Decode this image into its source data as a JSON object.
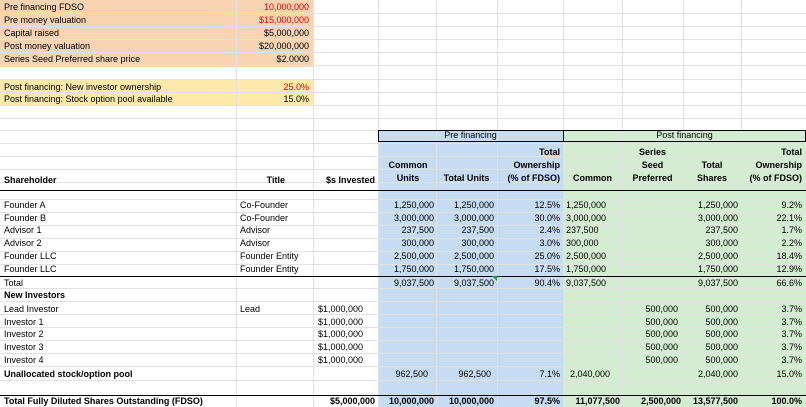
{
  "assumptions": [
    {
      "label": "Pre financing FDSO",
      "value": "10,000,000",
      "red": true
    },
    {
      "label": "Pre money valuation",
      "value": "$15,000,000",
      "red": true
    },
    {
      "label": "Capital raised",
      "value": "$5,000,000",
      "red": false
    },
    {
      "label": "Post money valuation",
      "value": "$20,000,000",
      "red": false
    },
    {
      "label": "Series Seed Preferred share price",
      "value": "$2.0000",
      "red": false
    }
  ],
  "post_assumptions": [
    {
      "label": "Post financing: New investor ownership",
      "value": "25.0%",
      "red": true
    },
    {
      "label": "Post financing: Stock option pool available",
      "value": "15.0%",
      "red": false
    }
  ],
  "groups": {
    "pre": "Pre financing",
    "post": "Post financing"
  },
  "headers": {
    "shareholder": "Shareholder",
    "title": "Title",
    "invested": "$s Invested",
    "common_units_1": "Common",
    "common_units_2": "Units",
    "total_units": "Total Units",
    "pre_own_1": "Total",
    "pre_own_2": "Ownership",
    "pre_own_3": "(% of FDSO)",
    "post_common": "Common",
    "series_1": "Series",
    "series_2": "Seed",
    "series_3": "Preferred",
    "total_shares_1": "Total",
    "total_shares_2": "Shares",
    "post_own_1": "Total",
    "post_own_2": "Ownership",
    "post_own_3": "(% of FDSO)"
  },
  "founders": [
    {
      "name": "Founder A",
      "title": "Co-Founder",
      "common_units": "1,250,000",
      "total_units": "1,250,000",
      "pre_own": "12.5%",
      "post_common": "1,250,000",
      "total_shares": "1,250,000",
      "post_own": "9.2%"
    },
    {
      "name": "Founder B",
      "title": "Co-Founder",
      "common_units": "3,000,000",
      "total_units": "3,000,000",
      "pre_own": "30.0%",
      "post_common": "3,000,000",
      "total_shares": "3,000,000",
      "post_own": "22.1%"
    },
    {
      "name": "Advisor 1",
      "title": "Advisor",
      "common_units": "237,500",
      "total_units": "237,500",
      "pre_own": "2.4%",
      "post_common": "237,500",
      "total_shares": "237,500",
      "post_own": "1.7%"
    },
    {
      "name": "Advisor 2",
      "title": "Advisor",
      "common_units": "300,000",
      "total_units": "300,000",
      "pre_own": "3.0%",
      "post_common": "300,000",
      "total_shares": "300,000",
      "post_own": "2.2%"
    },
    {
      "name": "Founder LLC",
      "title": "Founder Entity",
      "common_units": "2,500,000",
      "total_units": "2,500,000",
      "pre_own": "25.0%",
      "post_common": "2,500,000",
      "total_shares": "2,500,000",
      "post_own": "18.4%"
    },
    {
      "name": "Founder LLC",
      "title": "Founder Entity",
      "common_units": "1,750,000",
      "total_units": "1,750,000",
      "pre_own": "17.5%",
      "post_common": "1,750,000",
      "total_shares": "1,750,000",
      "post_own": "12.9%"
    }
  ],
  "total_row": {
    "name": "Total",
    "common_units": "9,037,500",
    "total_units": "9,037,500",
    "pre_own": "90.4%",
    "post_common": "9,037,500",
    "total_shares": "9,037,500",
    "post_own": "66.6%"
  },
  "new_investors_label": "New Investors",
  "investors": [
    {
      "name": "Lead Investor",
      "title": "Lead",
      "invested": "$1,000,000",
      "series": "500,000",
      "total_shares": "500,000",
      "post_own": "3.7%"
    },
    {
      "name": "Investor 1",
      "title": "",
      "invested": "$1,000,000",
      "series": "500,000",
      "total_shares": "500,000",
      "post_own": "3.7%"
    },
    {
      "name": "Investor 2",
      "title": "",
      "invested": "$1,000,000",
      "series": "500,000",
      "total_shares": "500,000",
      "post_own": "3.7%"
    },
    {
      "name": "Investor 3",
      "title": "",
      "invested": "$1,000,000",
      "series": "500,000",
      "total_shares": "500,000",
      "post_own": "3.7%"
    },
    {
      "name": "Investor 4",
      "title": "",
      "invested": "$1,000,000",
      "series": "500,000",
      "total_shares": "500,000",
      "post_own": "3.7%"
    }
  ],
  "pool_row": {
    "name": "Unallocated stock/option pool",
    "common_units": "962,500",
    "total_units": "962,500",
    "pre_own": "7.1%",
    "post_common": "2,040,000",
    "total_shares": "2,040,000",
    "post_own": "15.0%"
  },
  "fdso_row": {
    "name": "Total Fully Diluted Shares Outstanding (FDSO)",
    "invested": "$5,000,000",
    "common_units": "10,000,000",
    "total_units": "10,000,000",
    "pre_own": "97.5%",
    "post_common": "11,077,500",
    "series": "2,500,000",
    "total_shares": "13,577,500",
    "post_own": "100.0%"
  },
  "colors": {
    "assumption_fill": "#f9d4b3",
    "ownership_fill": "#fde9a9",
    "pre_fill": "#c5dcf2",
    "post_fill": "#d4ecd1",
    "red_input": "#e00000",
    "grid": "#e2e2e2"
  }
}
